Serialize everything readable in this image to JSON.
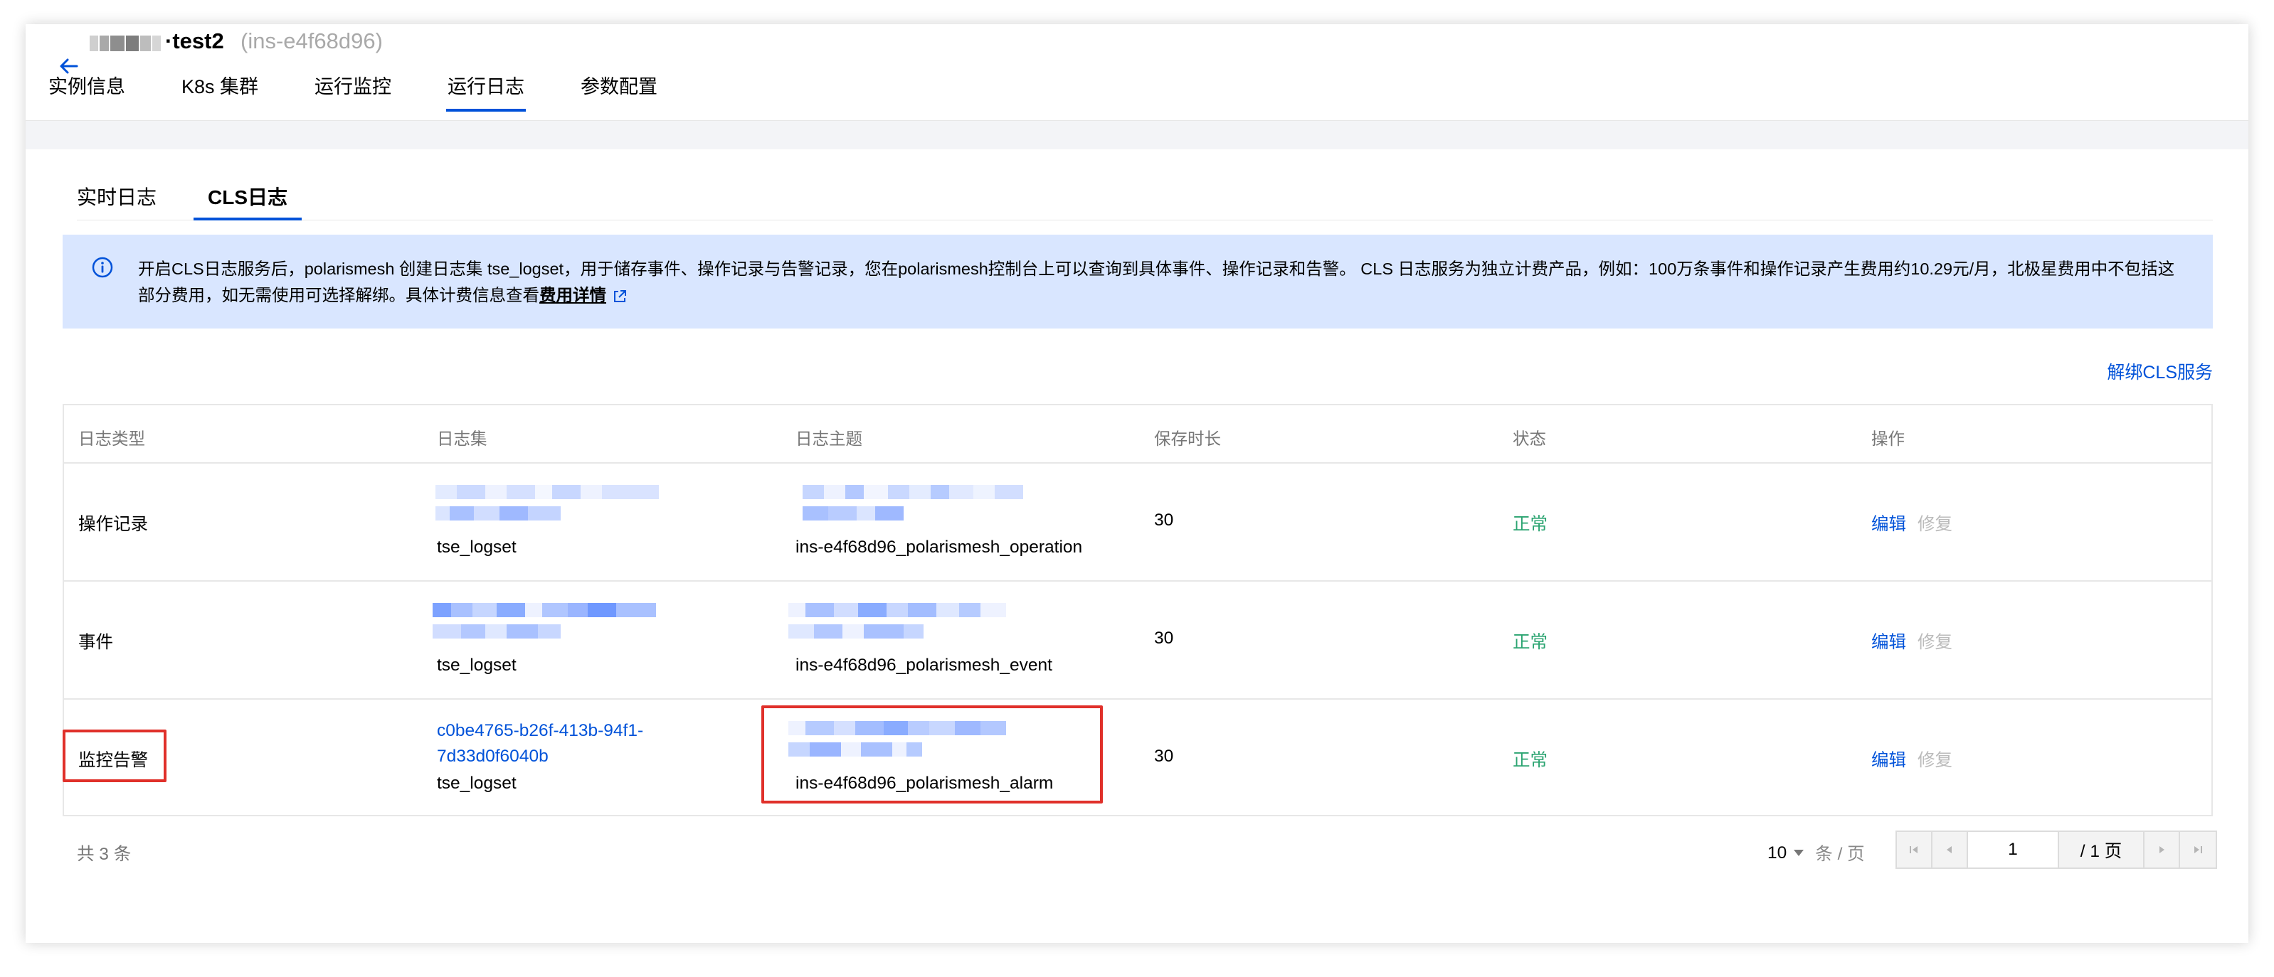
{
  "header": {
    "title": "·test2",
    "instance_id": "(ins-e4f68d96)"
  },
  "main_tabs": [
    {
      "label": "实例信息",
      "active": false
    },
    {
      "label": "K8s 集群",
      "active": false
    },
    {
      "label": "运行监控",
      "active": false
    },
    {
      "label": "运行日志",
      "active": true
    },
    {
      "label": "参数配置",
      "active": false
    }
  ],
  "sub_tabs": [
    {
      "label": "实时日志",
      "active": false
    },
    {
      "label": "CLS日志",
      "active": true
    }
  ],
  "notice": {
    "text": "开启CLS日志服务后，polarismesh 创建日志集 tse_logset，用于储存事件、操作记录与告警记录，您在polarismesh控制台上可以查询到具体事件、操作记录和告警。 CLS 日志服务为独立计费产品，例如：100万条事件和操作记录产生费用约10.29元/月，北极星费用中不包括这部分费用，如无需使用可选择解绑。具体计费信息查看",
    "link": "费用详情"
  },
  "unbind_link": "解绑CLS服务",
  "table": {
    "headers": [
      "日志类型",
      "日志集",
      "日志主题",
      "保存时长",
      "状态",
      "操作"
    ],
    "rows": [
      {
        "type": "操作记录",
        "logset_id": "",
        "logset_name": "tse_logset",
        "topic": "ins-e4f68d96_polarismesh_operation",
        "retention": "30",
        "status": "正常",
        "edit": "编辑",
        "repair": "修复"
      },
      {
        "type": "事件",
        "logset_id": "",
        "logset_name": "tse_logset",
        "topic": "ins-e4f68d96_polarismesh_event",
        "retention": "30",
        "status": "正常",
        "edit": "编辑",
        "repair": "修复"
      },
      {
        "type": "监控告警",
        "logset_id_line1": "c0be4765-b26f-413b-94f1-",
        "logset_id_line2": "7d33d0f6040b",
        "logset_name": "tse_logset",
        "topic": "ins-e4f68d96_polarismesh_alarm",
        "retention": "30",
        "status": "正常",
        "edit": "编辑",
        "repair": "修复"
      }
    ]
  },
  "footer": {
    "total": "共 3 条",
    "page_size": "10",
    "per_page": "条 / 页",
    "current_page": "1",
    "total_pages": "/ 1 页"
  },
  "colors": {
    "accent": "#0052d9",
    "status_ok": "#2ba471",
    "notice_bg": "#d9e6ff",
    "highlight": "#e0302a"
  }
}
